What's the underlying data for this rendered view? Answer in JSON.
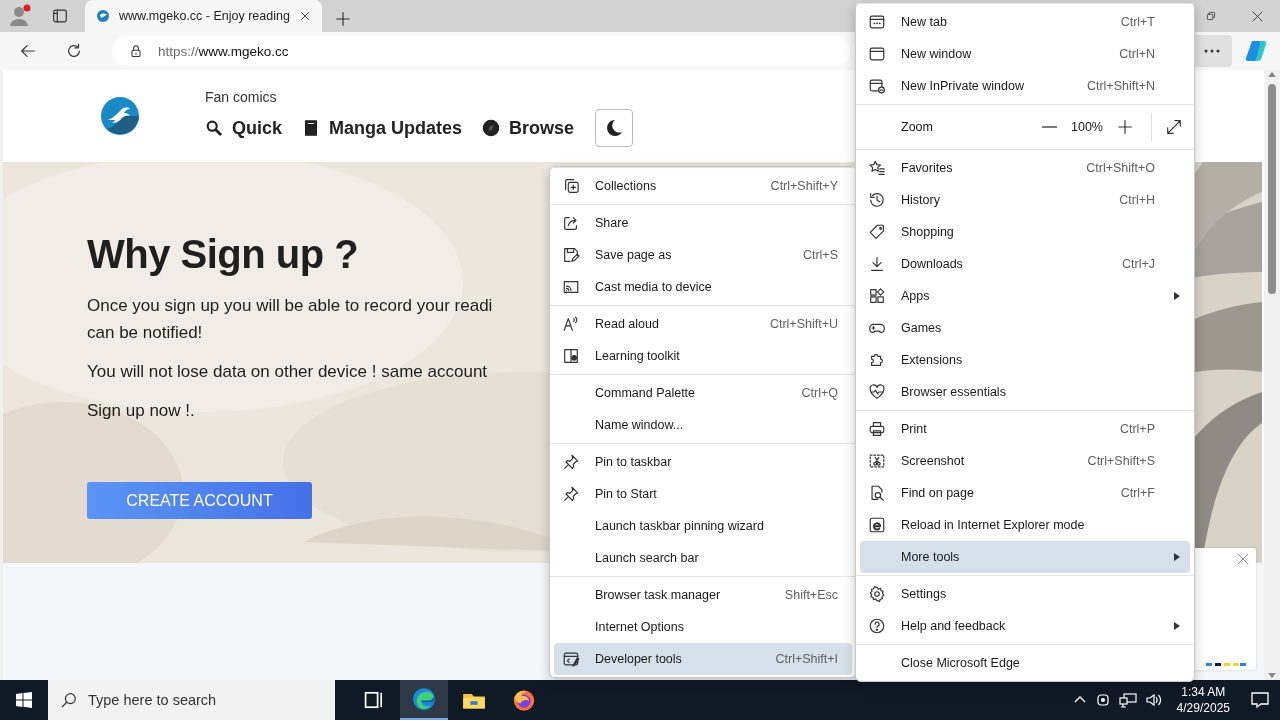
{
  "browser": {
    "tabs": [
      {
        "title": "www.mgeko.cc - Enjoy reading",
        "selected": true
      }
    ],
    "address": {
      "scheme": "https://",
      "host": "www.mgeko.cc"
    }
  },
  "page": {
    "tagline": "Fan comics",
    "nav": [
      {
        "kind": "search",
        "label": "Quick"
      },
      {
        "kind": "book",
        "label": "Manga Updates"
      },
      {
        "kind": "compass",
        "label": "Browse"
      }
    ],
    "hero": {
      "title": "Why Sign up ?",
      "paragraphs": [
        [
          "Once you sign up you will be able to record your readi",
          "can be notified!"
        ],
        [
          "You will not lose data on other device ! same account"
        ],
        [
          "Sign up now !."
        ]
      ],
      "button": "CREATE ACCOUNT"
    }
  },
  "main_menu": {
    "groups": [
      {
        "items": [
          {
            "kind": "new-tab",
            "label": "New tab",
            "shortcut": "Ctrl+T",
            "submenu": false,
            "selected": false
          },
          {
            "kind": "new-window",
            "label": "New window",
            "shortcut": "Ctrl+N",
            "submenu": false,
            "selected": false
          },
          {
            "kind": "inprivate",
            "label": "New InPrivate window",
            "shortcut": "Ctrl+Shift+N",
            "submenu": false,
            "selected": false
          }
        ]
      },
      {
        "items": [
          {
            "kind": "zoom",
            "label": "Zoom",
            "value": "100%",
            "selected": false
          }
        ]
      },
      {
        "items": [
          {
            "kind": "favorites",
            "label": "Favorites",
            "shortcut": "Ctrl+Shift+O",
            "submenu": false,
            "selected": false
          },
          {
            "kind": "history",
            "label": "History",
            "shortcut": "Ctrl+H",
            "submenu": false,
            "selected": false
          },
          {
            "kind": "shopping",
            "label": "Shopping",
            "submenu": false,
            "selected": false
          },
          {
            "kind": "downloads",
            "label": "Downloads",
            "shortcut": "Ctrl+J",
            "submenu": false,
            "selected": false
          },
          {
            "kind": "apps",
            "label": "Apps",
            "submenu": true,
            "selected": false
          },
          {
            "kind": "games",
            "label": "Games",
            "submenu": false,
            "selected": false
          },
          {
            "kind": "extensions",
            "label": "Extensions",
            "submenu": false,
            "selected": false
          },
          {
            "kind": "essentials",
            "label": "Browser essentials",
            "submenu": false,
            "selected": false
          }
        ]
      },
      {
        "items": [
          {
            "kind": "print",
            "label": "Print",
            "shortcut": "Ctrl+P",
            "submenu": false,
            "selected": false
          },
          {
            "kind": "screenshot",
            "label": "Screenshot",
            "shortcut": "Ctrl+Shift+S",
            "submenu": false,
            "selected": false
          },
          {
            "kind": "find",
            "label": "Find on page",
            "shortcut": "Ctrl+F",
            "submenu": false,
            "selected": false
          },
          {
            "kind": "ie",
            "label": "Reload in Internet Explorer mode",
            "submenu": false,
            "selected": false
          },
          {
            "kind": "plain",
            "label": "More tools",
            "submenu": true,
            "selected": true
          }
        ]
      },
      {
        "items": [
          {
            "kind": "settings",
            "label": "Settings",
            "submenu": false,
            "selected": false
          },
          {
            "kind": "help",
            "label": "Help and feedback",
            "submenu": true,
            "selected": false
          }
        ]
      },
      {
        "items": [
          {
            "kind": "plain",
            "label": "Close Microsoft Edge",
            "submenu": false,
            "selected": false
          }
        ]
      }
    ]
  },
  "more_tools_menu": {
    "groups": [
      {
        "items": [
          {
            "kind": "collections",
            "label": "Collections",
            "shortcut": "Ctrl+Shift+Y",
            "selected": false
          }
        ]
      },
      {
        "items": [
          {
            "kind": "share",
            "label": "Share",
            "selected": false
          },
          {
            "kind": "save",
            "label": "Save page as",
            "shortcut": "Ctrl+S",
            "selected": false
          },
          {
            "kind": "cast",
            "label": "Cast media to device",
            "selected": false
          }
        ]
      },
      {
        "items": [
          {
            "kind": "read-aloud",
            "label": "Read aloud",
            "shortcut": "Ctrl+Shift+U",
            "selected": false
          },
          {
            "kind": "learning",
            "label": "Learning toolkit",
            "selected": false
          }
        ]
      },
      {
        "items": [
          {
            "kind": "plain",
            "label": "Command Palette",
            "shortcut": "Ctrl+Q",
            "selected": false
          },
          {
            "kind": "plain",
            "label": "Name window...",
            "selected": false
          }
        ]
      },
      {
        "items": [
          {
            "kind": "pin",
            "label": "Pin to taskbar",
            "selected": false
          },
          {
            "kind": "pin",
            "label": "Pin to Start",
            "selected": false
          },
          {
            "kind": "plain",
            "label": "Launch taskbar pinning wizard",
            "selected": false
          },
          {
            "kind": "plain",
            "label": "Launch search bar",
            "selected": false
          }
        ]
      },
      {
        "items": [
          {
            "kind": "plain",
            "label": "Browser task manager",
            "shortcut": "Shift+Esc",
            "selected": false
          },
          {
            "kind": "plain",
            "label": "Internet Options",
            "selected": false
          },
          {
            "kind": "devtools",
            "label": "Developer tools",
            "shortcut": "Ctrl+Shift+I",
            "selected": true
          }
        ]
      }
    ]
  },
  "taskbar": {
    "search_placeholder": "Type here to search",
    "apps": [
      {
        "kind": "taskview",
        "selected": false
      },
      {
        "kind": "edge",
        "selected": true
      },
      {
        "kind": "folder",
        "selected": false
      },
      {
        "kind": "firefox",
        "selected": false
      }
    ],
    "time": "1:34 AM",
    "date": "4/29/2025"
  }
}
